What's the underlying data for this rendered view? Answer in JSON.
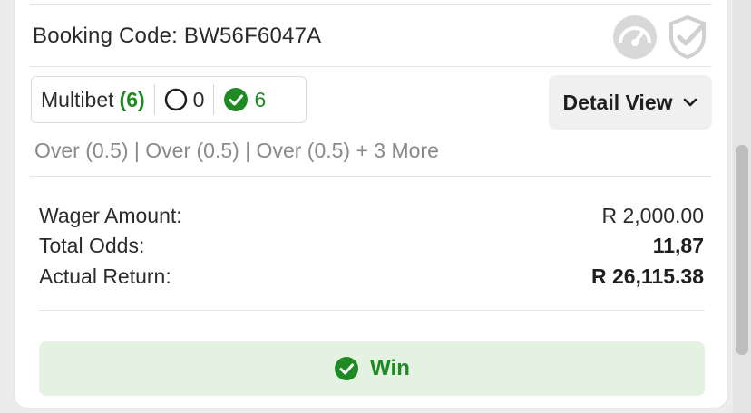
{
  "booking": {
    "code_label": "Booking Code: BW56F6047A",
    "icons": [
      "speedometer-icon",
      "shield-check-icon"
    ]
  },
  "bet_summary": {
    "type_label": "Multibet",
    "leg_count": "(6)",
    "open_count": "0",
    "won_count": "6",
    "detail_button_label": "Detail View"
  },
  "selections_text": "Over (0.5) | Over (0.5) | Over (0.5) + 3 More",
  "financials": {
    "wager_label": "Wager Amount:",
    "wager_value": "R 2,000.00",
    "odds_label": "Total Odds:",
    "odds_value": "11,87",
    "return_label": "Actual Return:",
    "return_value": "R 26,115.38"
  },
  "result": {
    "label": "Win",
    "icon": "check-circle-icon"
  },
  "colors": {
    "success_green": "#1f8a24",
    "win_bg": "#e4f3e1",
    "muted_text": "#8a8a8a"
  }
}
